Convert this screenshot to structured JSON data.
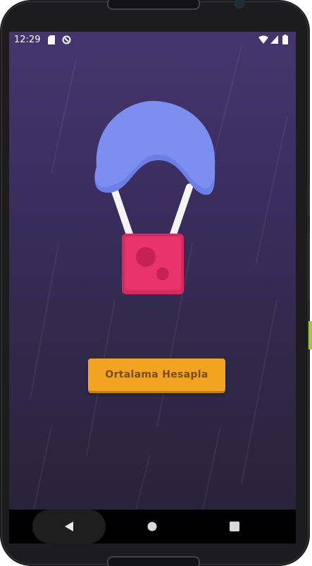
{
  "status_bar": {
    "time": "12:29",
    "left_icons": [
      "sd-card-icon",
      "data-saver-icon"
    ],
    "right_icons": [
      "wifi-icon",
      "cell-signal-icon",
      "battery-icon"
    ]
  },
  "main": {
    "button_label": "Ortalama Hesapla",
    "colors": {
      "background_top": "#45356f",
      "background_bottom": "#28233a",
      "parachute": "#7c8ff0",
      "crate": "#e8336f",
      "button": "#f2a421",
      "button_text": "#7a4c12"
    }
  },
  "navigation_bar": {
    "icons": [
      "back-icon",
      "home-icon",
      "recents-icon"
    ]
  }
}
